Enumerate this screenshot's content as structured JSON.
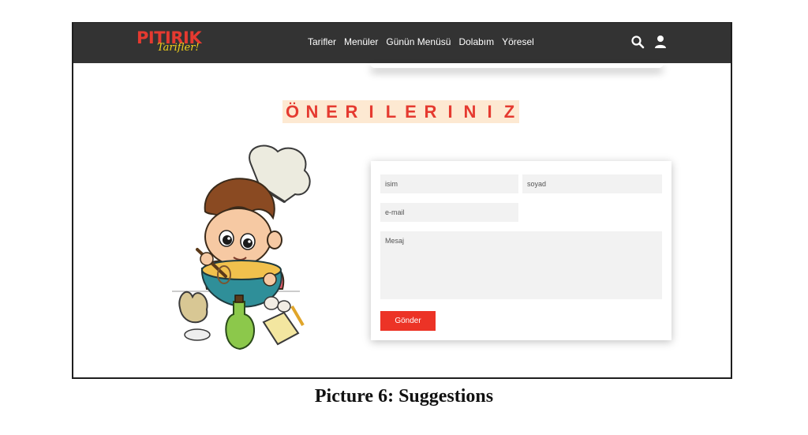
{
  "brand": {
    "name": "PITIRIK",
    "tagline": "Tarifler!"
  },
  "nav": {
    "items": [
      {
        "label": "Tarifler"
      },
      {
        "label": "Menüler"
      },
      {
        "label": "Günün Menüsü"
      },
      {
        "label": "Dolabım"
      },
      {
        "label": "Yöresel"
      }
    ],
    "icons": [
      "search-icon",
      "user-icon"
    ]
  },
  "page": {
    "heading_letters": [
      "Ö",
      "N",
      "E",
      "R",
      "I",
      "L",
      "E",
      "R",
      "I",
      "N",
      "I",
      "Z"
    ]
  },
  "form": {
    "name_placeholder": "isim",
    "surname_placeholder": "soyad",
    "email_placeholder": "e-mail",
    "message_placeholder": "Mesaj",
    "submit_label": "Gönder"
  },
  "caption": "Picture 6: Suggestions",
  "colors": {
    "navbar": "#333333",
    "accent": "#ec3326",
    "heading_bg": "#fde9d2",
    "tagline": "#f2d21b"
  }
}
